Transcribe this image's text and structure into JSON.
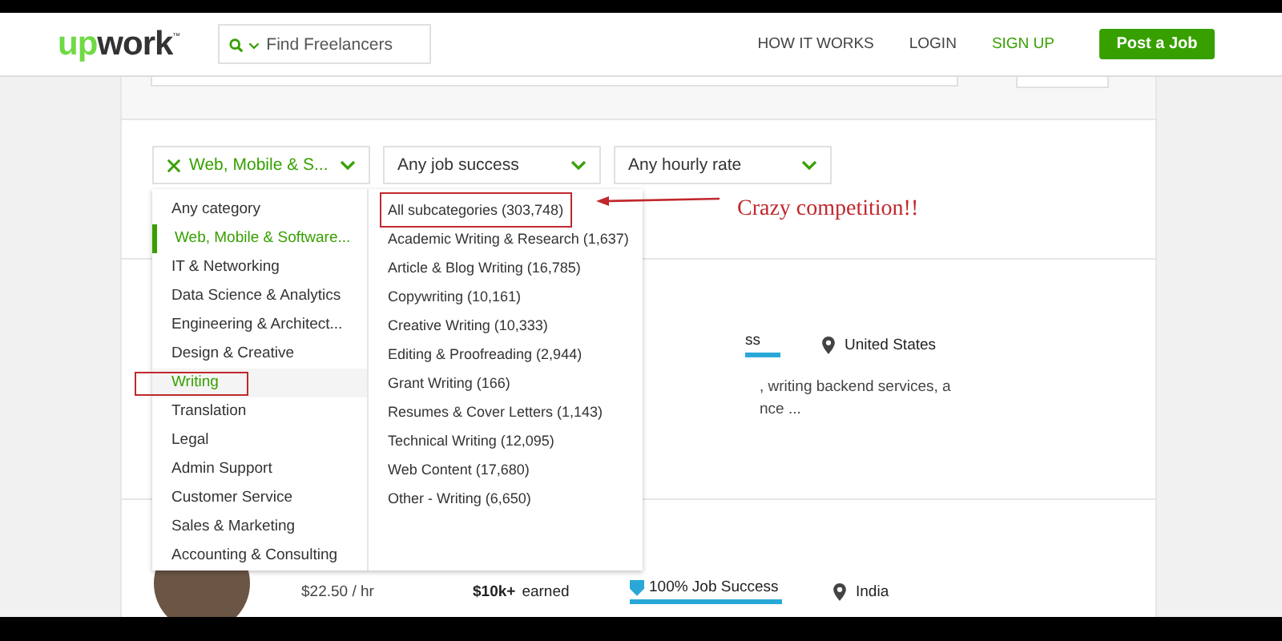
{
  "header": {
    "logo": {
      "accent": "up",
      "rest": "work",
      "mark": "™"
    },
    "search": {
      "placeholder": "Find Freelancers"
    },
    "nav": [
      {
        "label": "HOW IT WORKS",
        "kind": "plain"
      },
      {
        "label": "LOGIN",
        "kind": "plain"
      },
      {
        "label": "SIGN UP",
        "kind": "accent"
      }
    ],
    "post_button": "Post a Job"
  },
  "filters": [
    {
      "label": "Web, Mobile & S...",
      "clearable": true
    },
    {
      "label": "Any job success",
      "clearable": false
    },
    {
      "label": "Any hourly rate",
      "clearable": false
    }
  ],
  "category_menu": {
    "categories": [
      {
        "label": "Any category",
        "selected": false,
        "highlighted": false
      },
      {
        "label": "Web, Mobile & Software...",
        "selected": true,
        "highlighted": false
      },
      {
        "label": "IT & Networking",
        "selected": false,
        "highlighted": false
      },
      {
        "label": "Data Science & Analytics",
        "selected": false,
        "highlighted": false
      },
      {
        "label": "Engineering & Architect...",
        "selected": false,
        "highlighted": false
      },
      {
        "label": "Design & Creative",
        "selected": false,
        "highlighted": false
      },
      {
        "label": "Writing",
        "selected": false,
        "highlighted": true
      },
      {
        "label": "Translation",
        "selected": false,
        "highlighted": false
      },
      {
        "label": "Legal",
        "selected": false,
        "highlighted": false
      },
      {
        "label": "Admin Support",
        "selected": false,
        "highlighted": false
      },
      {
        "label": "Customer Service",
        "selected": false,
        "highlighted": false
      },
      {
        "label": "Sales & Marketing",
        "selected": false,
        "highlighted": false
      },
      {
        "label": "Accounting & Consulting",
        "selected": false,
        "highlighted": false
      }
    ],
    "subcategories": [
      {
        "label": "All subcategories (303,748)",
        "annotated": true
      },
      {
        "label": "Academic Writing & Research (1,637)",
        "annotated": false
      },
      {
        "label": "Article & Blog Writing (16,785)",
        "annotated": false
      },
      {
        "label": "Copywriting (10,161)",
        "annotated": false
      },
      {
        "label": "Creative Writing (10,333)",
        "annotated": false
      },
      {
        "label": "Editing & Proofreading (2,944)",
        "annotated": false
      },
      {
        "label": "Grant Writing (166)",
        "annotated": false
      },
      {
        "label": "Resumes & Cover Letters (1,143)",
        "annotated": false
      },
      {
        "label": "Technical Writing (12,095)",
        "annotated": false
      },
      {
        "label": "Web Content (17,680)",
        "annotated": false
      },
      {
        "label": "Other - Writing (6,650)",
        "annotated": false
      }
    ]
  },
  "annotation": {
    "text": "Crazy competition!!"
  },
  "freelancers": [
    {
      "job_success": "ss",
      "location": "United States",
      "description": [
        ", writing backend services, a",
        "nce ..."
      ]
    },
    {
      "rate": "$22.50 / hr",
      "earned_amount": "$10k+",
      "earned_label": "earned",
      "job_success": "100% Job Success",
      "location": "India"
    }
  ]
}
